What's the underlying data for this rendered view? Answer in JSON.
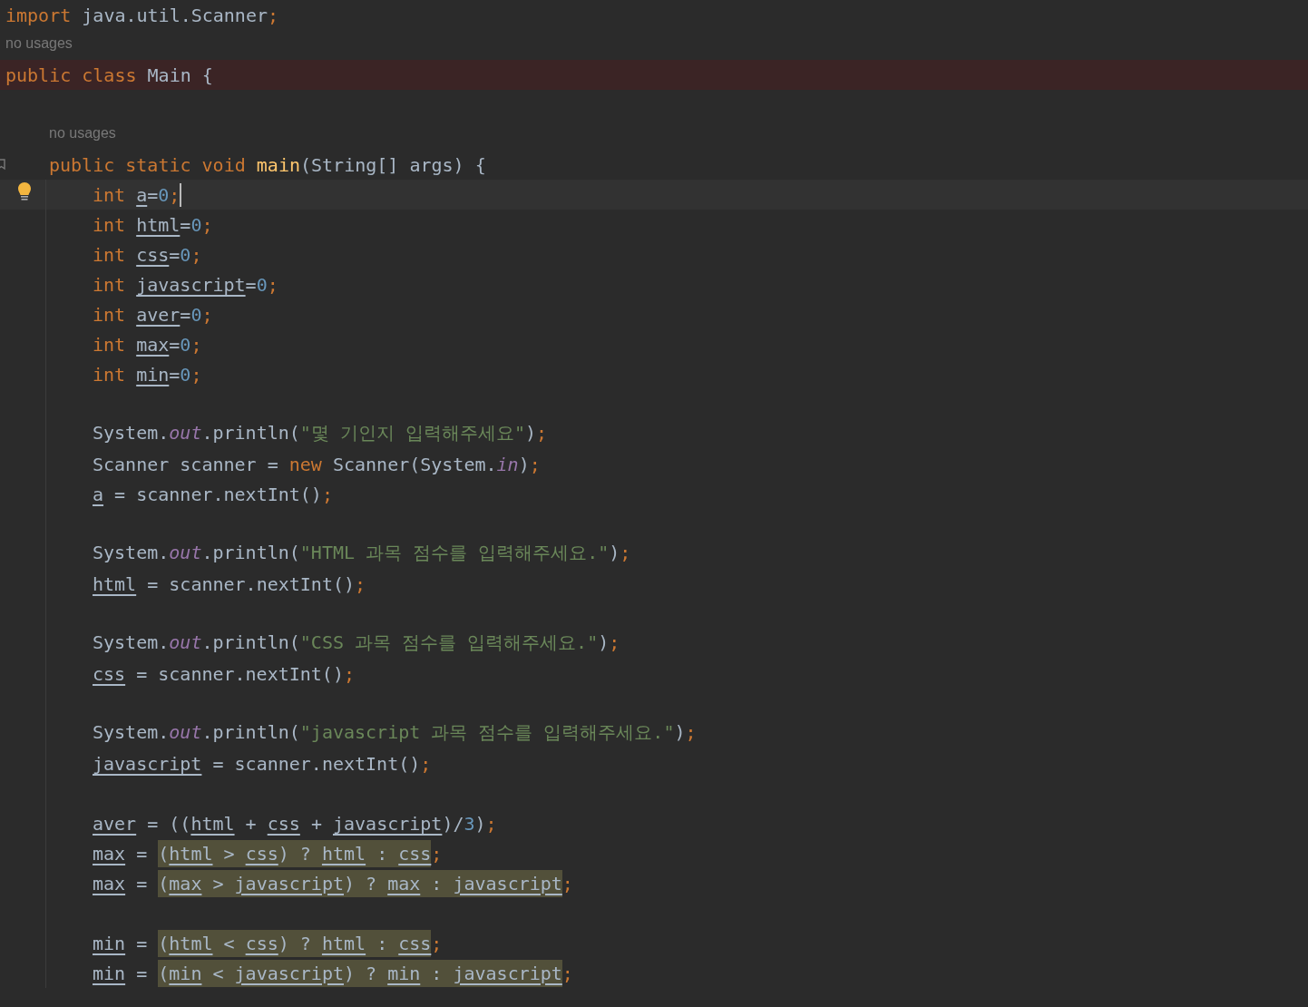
{
  "lines": [
    {
      "kind": "code",
      "tokens": [
        {
          "text": "import",
          "kind": "keyword"
        },
        {
          "text": " java.util.Scanner",
          "kind": "plain"
        },
        {
          "text": ";",
          "kind": "semicolon"
        }
      ]
    },
    {
      "kind": "hint",
      "text": "no usages"
    },
    {
      "kind": "code",
      "error": true,
      "tokens": [
        {
          "text": "public class",
          "kind": "keyword"
        },
        {
          "text": " Main {",
          "kind": "plain"
        }
      ],
      "children": [
        {
          "kind": "blank"
        },
        {
          "kind": "hint",
          "text": "no usages"
        },
        {
          "kind": "code",
          "gutter_marker": true,
          "tokens": [
            {
              "text": "public static void ",
              "kind": "keyword"
            },
            {
              "text": "main",
              "kind": "method"
            },
            {
              "text": "(String[] args) {",
              "kind": "plain"
            }
          ],
          "children": [
            {
              "kind": "code",
              "current": true,
              "lightbulb": true,
              "caret": true,
              "tokens": [
                {
                  "text": "int ",
                  "kind": "keyword"
                },
                {
                  "text": "a",
                  "kind": "variable"
                },
                {
                  "text": "=",
                  "kind": "plain"
                },
                {
                  "text": "0",
                  "kind": "number"
                },
                {
                  "text": ";",
                  "kind": "semicolon"
                }
              ]
            },
            {
              "kind": "code",
              "tokens": [
                {
                  "text": "int ",
                  "kind": "keyword"
                },
                {
                  "text": "html",
                  "kind": "variable"
                },
                {
                  "text": "=",
                  "kind": "plain"
                },
                {
                  "text": "0",
                  "kind": "number"
                },
                {
                  "text": ";",
                  "kind": "semicolon"
                }
              ]
            },
            {
              "kind": "code",
              "tokens": [
                {
                  "text": "int ",
                  "kind": "keyword"
                },
                {
                  "text": "css",
                  "kind": "variable"
                },
                {
                  "text": "=",
                  "kind": "plain"
                },
                {
                  "text": "0",
                  "kind": "number"
                },
                {
                  "text": ";",
                  "kind": "semicolon"
                }
              ]
            },
            {
              "kind": "code",
              "tokens": [
                {
                  "text": "int ",
                  "kind": "keyword"
                },
                {
                  "text": "javascript",
                  "kind": "variable"
                },
                {
                  "text": "=",
                  "kind": "plain"
                },
                {
                  "text": "0",
                  "kind": "number"
                },
                {
                  "text": ";",
                  "kind": "semicolon"
                }
              ]
            },
            {
              "kind": "code",
              "tokens": [
                {
                  "text": "int ",
                  "kind": "keyword"
                },
                {
                  "text": "aver",
                  "kind": "variable"
                },
                {
                  "text": "=",
                  "kind": "plain"
                },
                {
                  "text": "0",
                  "kind": "number"
                },
                {
                  "text": ";",
                  "kind": "semicolon"
                }
              ]
            },
            {
              "kind": "code",
              "tokens": [
                {
                  "text": "int ",
                  "kind": "keyword"
                },
                {
                  "text": "max",
                  "kind": "variable"
                },
                {
                  "text": "=",
                  "kind": "plain"
                },
                {
                  "text": "0",
                  "kind": "number"
                },
                {
                  "text": ";",
                  "kind": "semicolon"
                }
              ]
            },
            {
              "kind": "code",
              "tokens": [
                {
                  "text": "int ",
                  "kind": "keyword"
                },
                {
                  "text": "min",
                  "kind": "variable"
                },
                {
                  "text": "=",
                  "kind": "plain"
                },
                {
                  "text": "0",
                  "kind": "number"
                },
                {
                  "text": ";",
                  "kind": "semicolon"
                }
              ]
            },
            {
              "kind": "blank"
            },
            {
              "kind": "code",
              "tokens": [
                {
                  "text": "System.",
                  "kind": "plain"
                },
                {
                  "text": "out",
                  "kind": "field"
                },
                {
                  "text": ".println(",
                  "kind": "plain"
                },
                {
                  "text": "\"몇 기인지 입력해주세요\"",
                  "kind": "string"
                },
                {
                  "text": ")",
                  "kind": "plain"
                },
                {
                  "text": ";",
                  "kind": "semicolon"
                }
              ]
            },
            {
              "kind": "code",
              "tokens": [
                {
                  "text": "Scanner scanner = ",
                  "kind": "plain"
                },
                {
                  "text": "new",
                  "kind": "keyword"
                },
                {
                  "text": " Scanner(System.",
                  "kind": "plain"
                },
                {
                  "text": "in",
                  "kind": "field"
                },
                {
                  "text": ")",
                  "kind": "plain"
                },
                {
                  "text": ";",
                  "kind": "semicolon"
                }
              ]
            },
            {
              "kind": "code",
              "tokens": [
                {
                  "text": "a",
                  "kind": "variable"
                },
                {
                  "text": " = scanner.nextInt()",
                  "kind": "plain"
                },
                {
                  "text": ";",
                  "kind": "semicolon"
                }
              ]
            },
            {
              "kind": "blank"
            },
            {
              "kind": "code",
              "tokens": [
                {
                  "text": "System.",
                  "kind": "plain"
                },
                {
                  "text": "out",
                  "kind": "field"
                },
                {
                  "text": ".println(",
                  "kind": "plain"
                },
                {
                  "text": "\"HTML 과목 점수를 입력해주세요.\"",
                  "kind": "string"
                },
                {
                  "text": ")",
                  "kind": "plain"
                },
                {
                  "text": ";",
                  "kind": "semicolon"
                }
              ]
            },
            {
              "kind": "code",
              "tokens": [
                {
                  "text": "html",
                  "kind": "variable"
                },
                {
                  "text": " = scanner.nextInt()",
                  "kind": "plain"
                },
                {
                  "text": ";",
                  "kind": "semicolon"
                }
              ]
            },
            {
              "kind": "blank"
            },
            {
              "kind": "code",
              "tokens": [
                {
                  "text": "System.",
                  "kind": "plain"
                },
                {
                  "text": "out",
                  "kind": "field"
                },
                {
                  "text": ".println(",
                  "kind": "plain"
                },
                {
                  "text": "\"CSS 과목 점수를 입력해주세요.\"",
                  "kind": "string"
                },
                {
                  "text": ")",
                  "kind": "plain"
                },
                {
                  "text": ";",
                  "kind": "semicolon"
                }
              ]
            },
            {
              "kind": "code",
              "tokens": [
                {
                  "text": "css",
                  "kind": "variable"
                },
                {
                  "text": " = scanner.nextInt()",
                  "kind": "plain"
                },
                {
                  "text": ";",
                  "kind": "semicolon"
                }
              ]
            },
            {
              "kind": "blank"
            },
            {
              "kind": "code",
              "tokens": [
                {
                  "text": "System.",
                  "kind": "plain"
                },
                {
                  "text": "out",
                  "kind": "field"
                },
                {
                  "text": ".println(",
                  "kind": "plain"
                },
                {
                  "text": "\"javascript 과목 점수를 입력해주세요.\"",
                  "kind": "string"
                },
                {
                  "text": ")",
                  "kind": "plain"
                },
                {
                  "text": ";",
                  "kind": "semicolon"
                }
              ]
            },
            {
              "kind": "code",
              "tokens": [
                {
                  "text": "javascript",
                  "kind": "variable"
                },
                {
                  "text": " = scanner.nextInt()",
                  "kind": "plain"
                },
                {
                  "text": ";",
                  "kind": "semicolon"
                }
              ]
            },
            {
              "kind": "blank"
            },
            {
              "kind": "code",
              "tokens": [
                {
                  "text": "aver",
                  "kind": "variable"
                },
                {
                  "text": " = ((",
                  "kind": "plain"
                },
                {
                  "text": "html",
                  "kind": "variable"
                },
                {
                  "text": " + ",
                  "kind": "plain"
                },
                {
                  "text": "css",
                  "kind": "variable"
                },
                {
                  "text": " + ",
                  "kind": "plain"
                },
                {
                  "text": "javascript",
                  "kind": "variable"
                },
                {
                  "text": ")/",
                  "kind": "plain"
                },
                {
                  "text": "3",
                  "kind": "number"
                },
                {
                  "text": ")",
                  "kind": "plain"
                },
                {
                  "text": ";",
                  "kind": "semicolon"
                }
              ]
            },
            {
              "kind": "code",
              "tokens": [
                {
                  "text": "max",
                  "kind": "variable"
                },
                {
                  "text": " = ",
                  "kind": "plain"
                },
                {
                  "kind": "highlight",
                  "tokens": [
                    {
                      "text": "(",
                      "kind": "plain"
                    },
                    {
                      "text": "html",
                      "kind": "variable"
                    },
                    {
                      "text": " > ",
                      "kind": "plain"
                    },
                    {
                      "text": "css",
                      "kind": "variable"
                    },
                    {
                      "text": ") ? ",
                      "kind": "plain"
                    },
                    {
                      "text": "html",
                      "kind": "variable"
                    },
                    {
                      "text": " : ",
                      "kind": "plain"
                    },
                    {
                      "text": "css",
                      "kind": "variable"
                    }
                  ]
                },
                {
                  "text": ";",
                  "kind": "semicolon"
                }
              ]
            },
            {
              "kind": "code",
              "tokens": [
                {
                  "text": "max",
                  "kind": "variable"
                },
                {
                  "text": " = ",
                  "kind": "plain"
                },
                {
                  "kind": "highlight",
                  "tokens": [
                    {
                      "text": "(",
                      "kind": "plain"
                    },
                    {
                      "text": "max",
                      "kind": "variable"
                    },
                    {
                      "text": " > ",
                      "kind": "plain"
                    },
                    {
                      "text": "javascript",
                      "kind": "variable"
                    },
                    {
                      "text": ") ? ",
                      "kind": "plain"
                    },
                    {
                      "text": "max",
                      "kind": "variable"
                    },
                    {
                      "text": " : ",
                      "kind": "plain"
                    },
                    {
                      "text": "javascript",
                      "kind": "variable"
                    }
                  ]
                },
                {
                  "text": ";",
                  "kind": "semicolon"
                }
              ]
            },
            {
              "kind": "blank"
            },
            {
              "kind": "code",
              "tokens": [
                {
                  "text": "min",
                  "kind": "variable"
                },
                {
                  "text": " = ",
                  "kind": "plain"
                },
                {
                  "kind": "highlight",
                  "tokens": [
                    {
                      "text": "(",
                      "kind": "plain"
                    },
                    {
                      "text": "html",
                      "kind": "variable"
                    },
                    {
                      "text": " < ",
                      "kind": "plain"
                    },
                    {
                      "text": "css",
                      "kind": "variable"
                    },
                    {
                      "text": ") ? ",
                      "kind": "plain"
                    },
                    {
                      "text": "html",
                      "kind": "variable"
                    },
                    {
                      "text": " : ",
                      "kind": "plain"
                    },
                    {
                      "text": "css",
                      "kind": "variable"
                    }
                  ]
                },
                {
                  "text": ";",
                  "kind": "semicolon"
                }
              ]
            },
            {
              "kind": "code",
              "tokens": [
                {
                  "text": "min",
                  "kind": "variable"
                },
                {
                  "text": " = ",
                  "kind": "plain"
                },
                {
                  "kind": "highlight",
                  "tokens": [
                    {
                      "text": "(",
                      "kind": "plain"
                    },
                    {
                      "text": "min",
                      "kind": "variable"
                    },
                    {
                      "text": " < ",
                      "kind": "plain"
                    },
                    {
                      "text": "javascript",
                      "kind": "variable"
                    },
                    {
                      "text": ") ? ",
                      "kind": "plain"
                    },
                    {
                      "text": "min",
                      "kind": "variable"
                    },
                    {
                      "text": " : ",
                      "kind": "plain"
                    },
                    {
                      "text": "javascript",
                      "kind": "variable"
                    }
                  ]
                },
                {
                  "text": ";",
                  "kind": "semicolon"
                }
              ]
            }
          ]
        }
      ]
    }
  ]
}
